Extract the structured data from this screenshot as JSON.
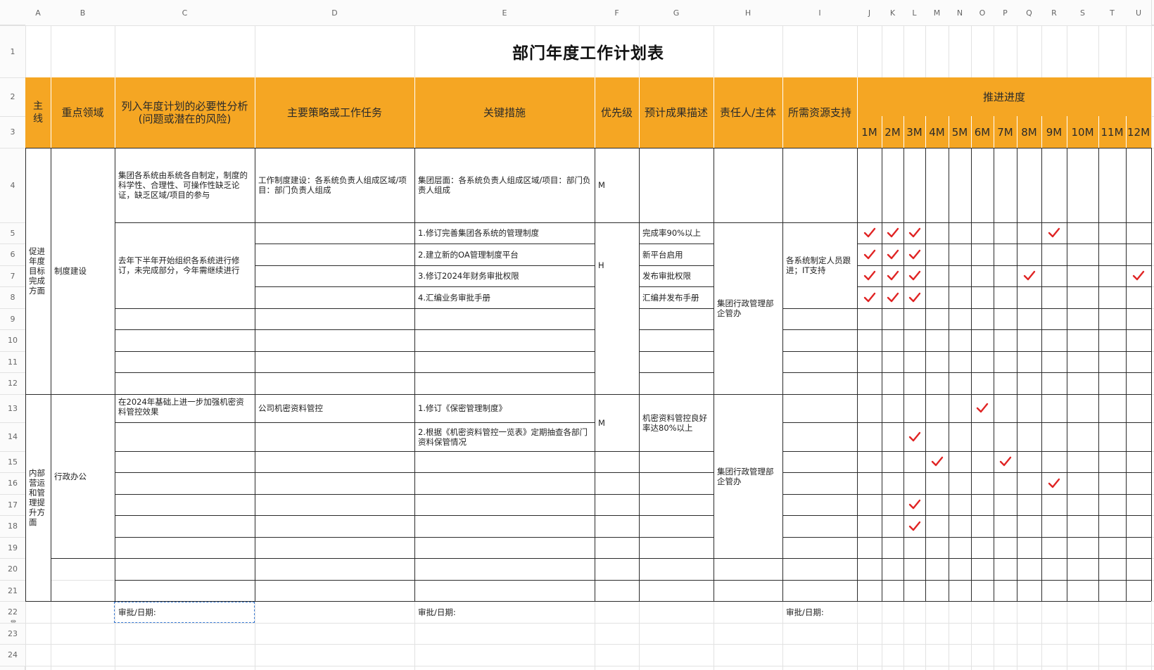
{
  "sheet": {
    "title": "部门年度工作计划表",
    "columns": [
      "A",
      "B",
      "C",
      "D",
      "E",
      "F",
      "G",
      "H",
      "I",
      "J",
      "K",
      "L",
      "M",
      "N",
      "O",
      "P",
      "Q",
      "R",
      "S",
      "T",
      "U"
    ],
    "rows": [
      "1",
      "2",
      "3",
      "4",
      "5",
      "6",
      "7",
      "8",
      "9",
      "10",
      "11",
      "12",
      "13",
      "14",
      "15",
      "16",
      "17",
      "18",
      "19",
      "20",
      "21",
      "22",
      "23",
      "24"
    ],
    "headers": {
      "main_line": "主线",
      "focus_area": "重点领域",
      "necessity": "列入年度计划的必要性分析\n(问题或潜在的风险)",
      "strategy": "主要策略或工作任务",
      "measures": "关键措施",
      "priority": "优先级",
      "outcome": "预计成果描述",
      "owner": "责任人/主体",
      "resources": "所需资源支持",
      "progress": "推进进度",
      "months": [
        "1M",
        "2M",
        "3M",
        "4M",
        "5M",
        "6M",
        "7M",
        "8M",
        "9M",
        "10M",
        "11M",
        "12M"
      ]
    },
    "sections": [
      {
        "main_line": "促进年度目标完成方面",
        "focus_area": "制度建设"
      },
      {
        "main_line": "内部营运和管理提升方面",
        "focus_area": "行政办公"
      }
    ],
    "cells": {
      "r4_necessity": "集团各系统由系统各自制定，制度的科学性、合理性、可操作性缺乏论证，缺乏区域/项目的参与",
      "r4_strategy": "工作制度建设：各系统负责人组成区域/项目：部门负责人组成",
      "r4_measures": "集团层面：各系统负责人组成区域/项目：部门负责人组成",
      "r4_priority": "M",
      "r5_necessity": "去年下半年开始组织各系统进行修订，未完成部分，今年需继续进行",
      "r5_priority": "H",
      "r5_measure": "1.修订完善集团各系统的管理制度",
      "r6_measure": "2.建立新的OA管理制度平台",
      "r7_measure": "3.修订2024年财务审批权限",
      "r8_measure": "4.汇编业务审批手册",
      "r5_outcome": "完成率90%以上",
      "r6_outcome": "新平台启用",
      "r7_outcome": "发布审批权限",
      "r8_outcome": "汇编并发布手册",
      "s1_owner": "集团行政管理部企管办",
      "s1_resources": "各系统制定人员跟进；IT支持",
      "r13_necessity": "在2024年基础上进一步加强机密资料管控效果",
      "r13_strategy": "公司机密资料管控",
      "r13_measure": "1.修订《保密管理制度》",
      "r14_measure": "2.根据《机密资料管控一览表》定期抽查各部门资料保管情况",
      "r13_priority": "M",
      "r13_outcome": "机密资料管控良好率达80%以上",
      "s2_owner": "集团行政管理部企管办",
      "r22_c": "审批/日期:",
      "r22_e": "审批/日期:",
      "r22_i": "审批/日期:"
    },
    "checks": [
      {
        "row": 5,
        "month": 1
      },
      {
        "row": 5,
        "month": 2
      },
      {
        "row": 5,
        "month": 3
      },
      {
        "row": 5,
        "month": 9
      },
      {
        "row": 6,
        "month": 1
      },
      {
        "row": 6,
        "month": 2
      },
      {
        "row": 6,
        "month": 3
      },
      {
        "row": 7,
        "month": 1
      },
      {
        "row": 7,
        "month": 2
      },
      {
        "row": 7,
        "month": 3
      },
      {
        "row": 7,
        "month": 8
      },
      {
        "row": 7,
        "month": 12
      },
      {
        "row": 8,
        "month": 1
      },
      {
        "row": 8,
        "month": 2
      },
      {
        "row": 8,
        "month": 3
      },
      {
        "row": 13,
        "month": 6
      },
      {
        "row": 14,
        "month": 3
      },
      {
        "row": 15,
        "month": 4
      },
      {
        "row": 15,
        "month": 7
      },
      {
        "row": 16,
        "month": 9
      },
      {
        "row": 17,
        "month": 3
      },
      {
        "row": 18,
        "month": 3
      }
    ],
    "colors": {
      "header_bg": "#f5a623",
      "check": "#e02424"
    },
    "icons": {
      "eye": "eye-icon",
      "check": "check-mark-icon"
    }
  }
}
